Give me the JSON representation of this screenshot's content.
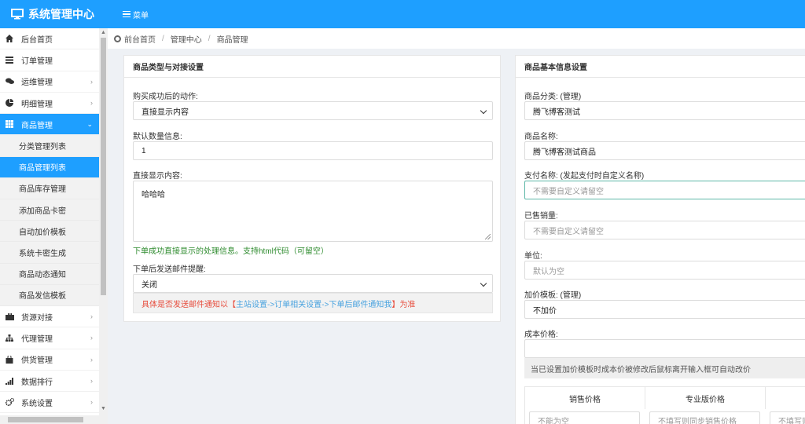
{
  "app": {
    "title": "系统管理中心",
    "menu_label": "菜单"
  },
  "sidebar": {
    "items": [
      {
        "label": "后台首页",
        "icon": "home-icon",
        "chevron": false
      },
      {
        "label": "订单管理",
        "icon": "list-icon",
        "chevron": false
      },
      {
        "label": "运维管理",
        "icon": "chat-icon",
        "chevron": true
      },
      {
        "label": "明细管理",
        "icon": "pie-chart-icon",
        "chevron": true
      },
      {
        "label": "商品管理",
        "icon": "grid-icon",
        "chevron": true,
        "active": true
      }
    ],
    "sub_items": [
      {
        "label": "分类管理列表"
      },
      {
        "label": "商品管理列表",
        "active": true
      },
      {
        "label": "商品库存管理"
      },
      {
        "label": "添加商品卡密"
      },
      {
        "label": "自动加价模板"
      },
      {
        "label": "系统卡密生成"
      },
      {
        "label": "商品动态通知"
      },
      {
        "label": "商品发信模板"
      }
    ],
    "items_after": [
      {
        "label": "货源对接",
        "icon": "briefcase-icon",
        "chevron": true
      },
      {
        "label": "代理管理",
        "icon": "sitemap-icon",
        "chevron": true
      },
      {
        "label": "供货管理",
        "icon": "bag-icon",
        "chevron": true
      },
      {
        "label": "数据排行",
        "icon": "bar-signal-icon",
        "chevron": true
      },
      {
        "label": "系统设置",
        "icon": "gears-icon",
        "chevron": true
      }
    ]
  },
  "breadcrumb": [
    "前台首页",
    "管理中心",
    "商品管理"
  ],
  "left_panel": {
    "title": "商品类型与对接设置",
    "action_label": "购买成功后的动作:",
    "action_value": "直接显示内容",
    "default_qty_label": "默认数量信息:",
    "default_qty_value": "1",
    "display_label": "直接显示内容:",
    "display_value": "哈哈哈",
    "display_hint": "下单成功直接显示的处理信息。支持html代码（可留空）",
    "email_label": "下单后发送邮件提醒:",
    "email_value": "关闭",
    "email_note_prefix": "具体是否发送邮件通知以【",
    "email_note_path": "主站设置->订单相关设置->下单后邮件通知我",
    "email_note_suffix": "】为准"
  },
  "right_panel": {
    "title": "商品基本信息设置",
    "category_label": "商品分类: (管理)",
    "category_value": "腾飞博客测试",
    "name_label": "商品名称:",
    "name_value": "腾飞博客测试商品",
    "pay_name_label": "支付名称: (发起支付时自定义名称)",
    "pay_name_placeholder": "不需要自定义请留空",
    "sold_label": "已售销量:",
    "sold_placeholder": "不需要自定义请留空",
    "unit_label": "单位:",
    "unit_placeholder": "默认为空",
    "markup_label": "加价模板: (管理)",
    "markup_value": "不加价",
    "cost_label": "成本价格:",
    "cost_note": "当已设置加价模板时成本价被修改后鼠标离开输入框可自动改价",
    "price_headers": [
      "销售价格",
      "专业版价格"
    ],
    "price_placeholders": [
      "不能为空",
      "不填写则同步销售价格",
      "不填写则同步"
    ]
  }
}
